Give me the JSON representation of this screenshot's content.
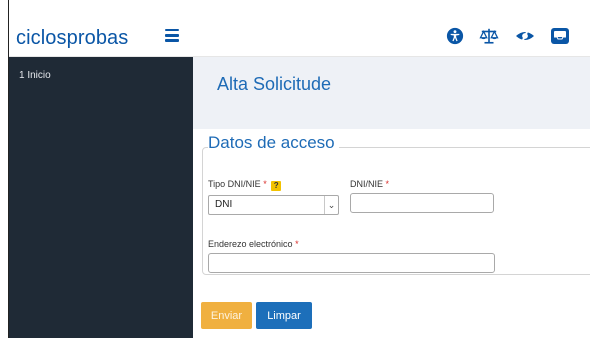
{
  "sidebar": {
    "brand": "ciclosprobas",
    "menu": [
      {
        "label": "1 Inicio"
      }
    ]
  },
  "topbar": {
    "icons": [
      "accessibility-icon",
      "scales-icon",
      "eye-icon",
      "inbox-icon"
    ]
  },
  "page": {
    "title": "Alta Solicitude"
  },
  "form": {
    "legend": "Datos de acceso",
    "tipo_label": "Tipo DNI/NIE",
    "tipo_required": "*",
    "help_glyph": "?",
    "tipo_value": "DNI",
    "dni_label": "DNI/NIE",
    "dni_required": "*",
    "dni_value": "",
    "email_label": "Enderezo electrónico",
    "email_required": "*",
    "email_value": ""
  },
  "buttons": {
    "submit": "Enviar",
    "reset": "Limpar"
  },
  "colors": {
    "brand": "#0a56a6",
    "sidebar_bg": "#1f2a36",
    "submit_bg": "#f0b040",
    "reset_bg": "#1d6fba",
    "required": "#d9302c"
  }
}
